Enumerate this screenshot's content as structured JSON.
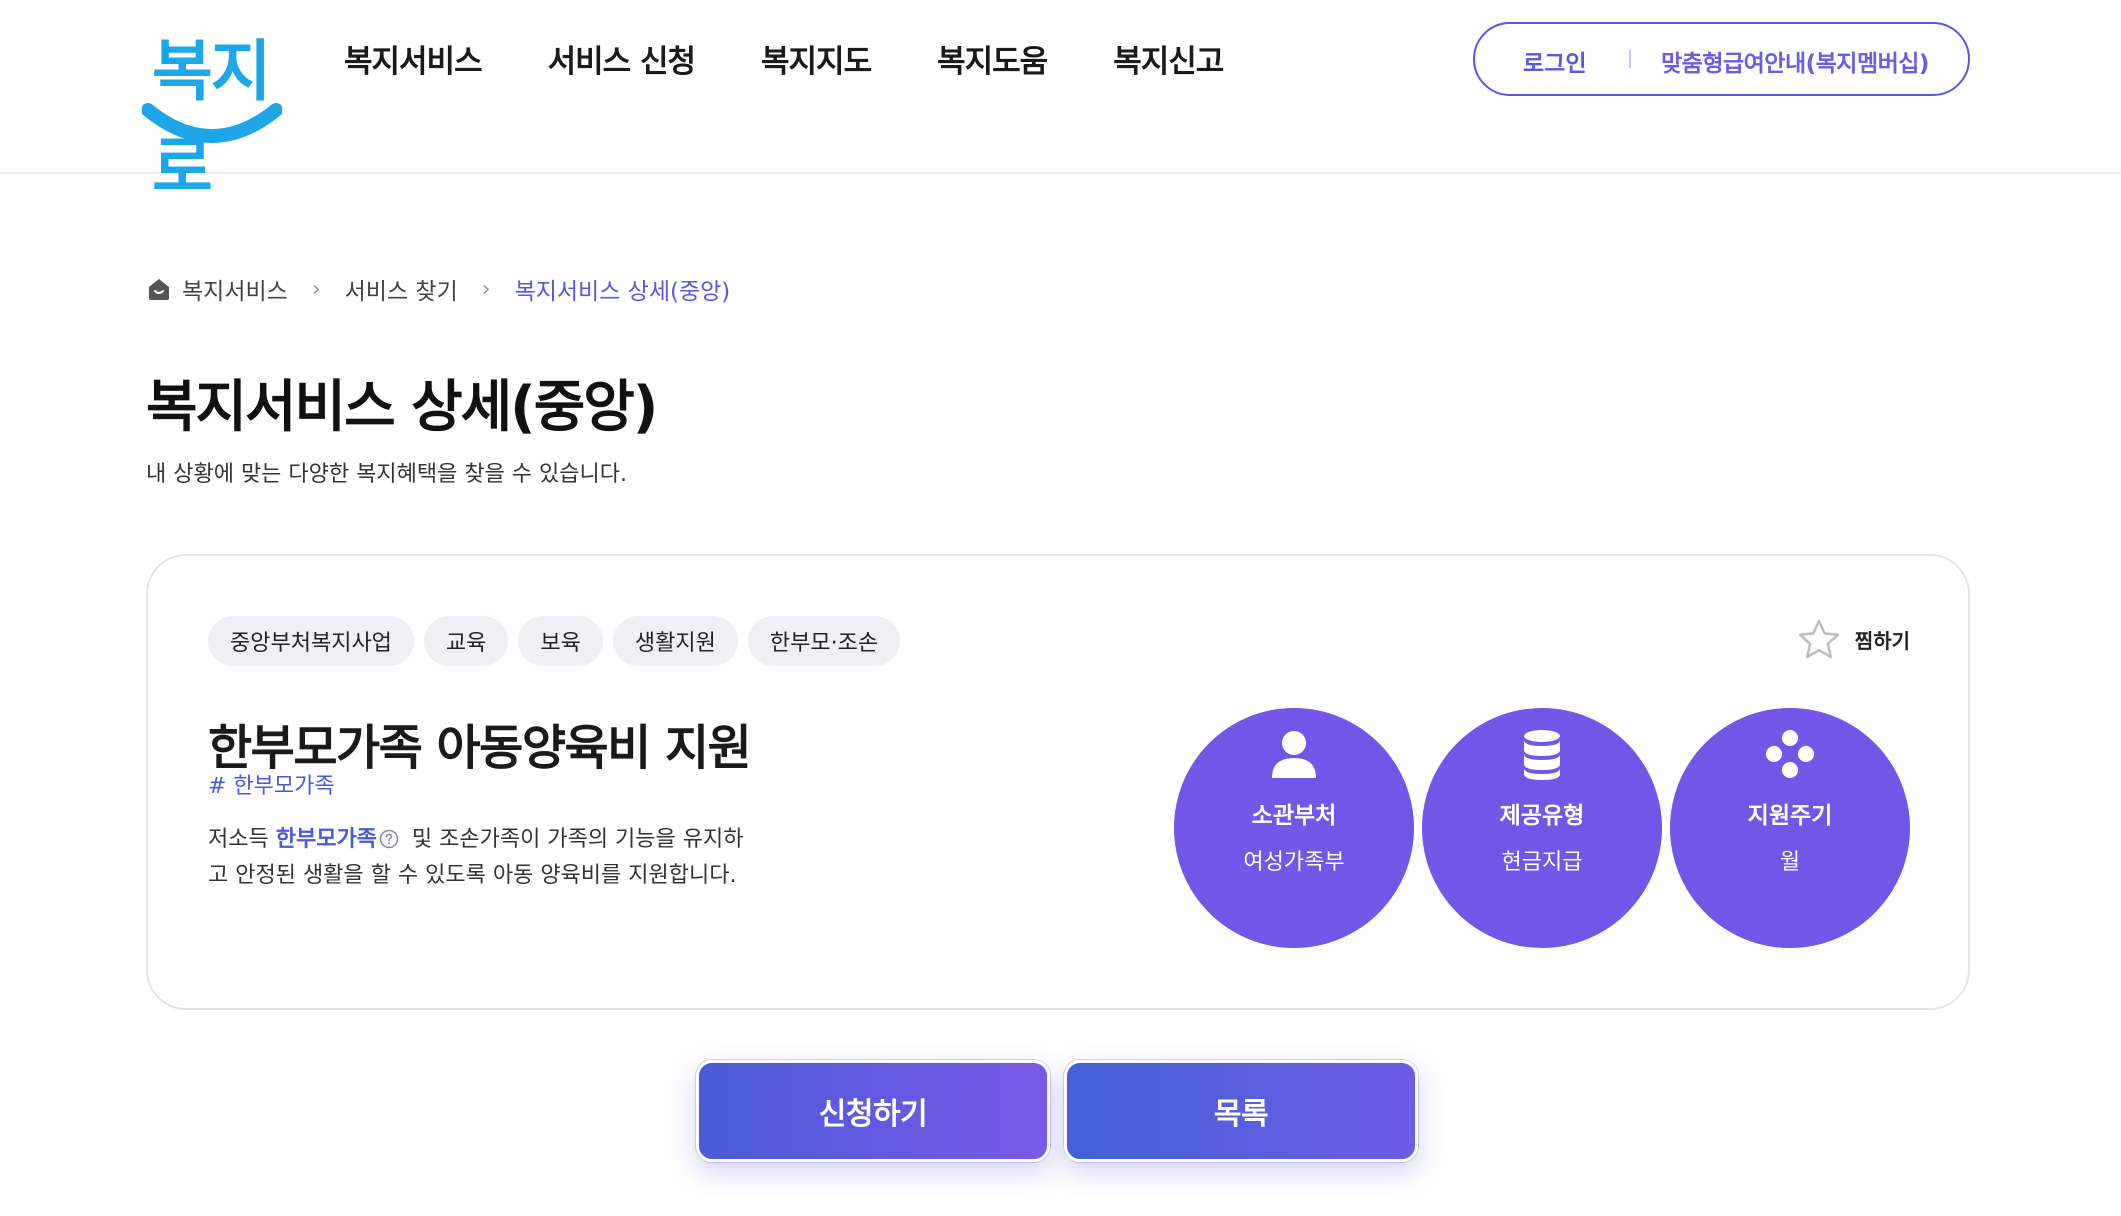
{
  "header": {
    "logo_text": "복지로",
    "nav": [
      "복지서비스",
      "서비스 신청",
      "복지지도",
      "복지도움",
      "복지신고"
    ],
    "login_label": "로그인",
    "membership_label": "맞춤형급여안내(복지멤버십)"
  },
  "breadcrumb": {
    "items": [
      "복지서비스",
      "서비스 찾기",
      "복지서비스 상세(중앙)"
    ]
  },
  "page": {
    "title": "복지서비스 상세(중앙)",
    "subtitle": "내 상황에 맞는 다양한 복지혜택을 찾을 수 있습니다."
  },
  "service": {
    "tags": [
      "중앙부처복지사업",
      "교육",
      "보육",
      "생활지원",
      "한부모·조손"
    ],
    "favorite_label": "찜하기",
    "title": "한부모가족 아동양육비 지원",
    "hashtag": "# 한부모가족",
    "desc_prefix": "저소득 ",
    "desc_highlight": "한부모가족",
    "desc_line1_rest": " 및 조손가족이 가족의 기능을 유지하",
    "desc_line2": "고 안정된 생활을 할 수 있도록 아동 양육비를 지원합니다.",
    "info": [
      {
        "icon": "person-icon",
        "label": "소관부처",
        "value": "여성가족부"
      },
      {
        "icon": "database-icon",
        "label": "제공유형",
        "value": "현금지급"
      },
      {
        "icon": "cycle-icon",
        "label": "지원주기",
        "value": "월"
      }
    ]
  },
  "actions": {
    "apply_label": "신청하기",
    "list_label": "목록"
  },
  "colors": {
    "accent": "#5b55e0",
    "circle": "#7156e7",
    "logo": "#1ea7e8"
  }
}
